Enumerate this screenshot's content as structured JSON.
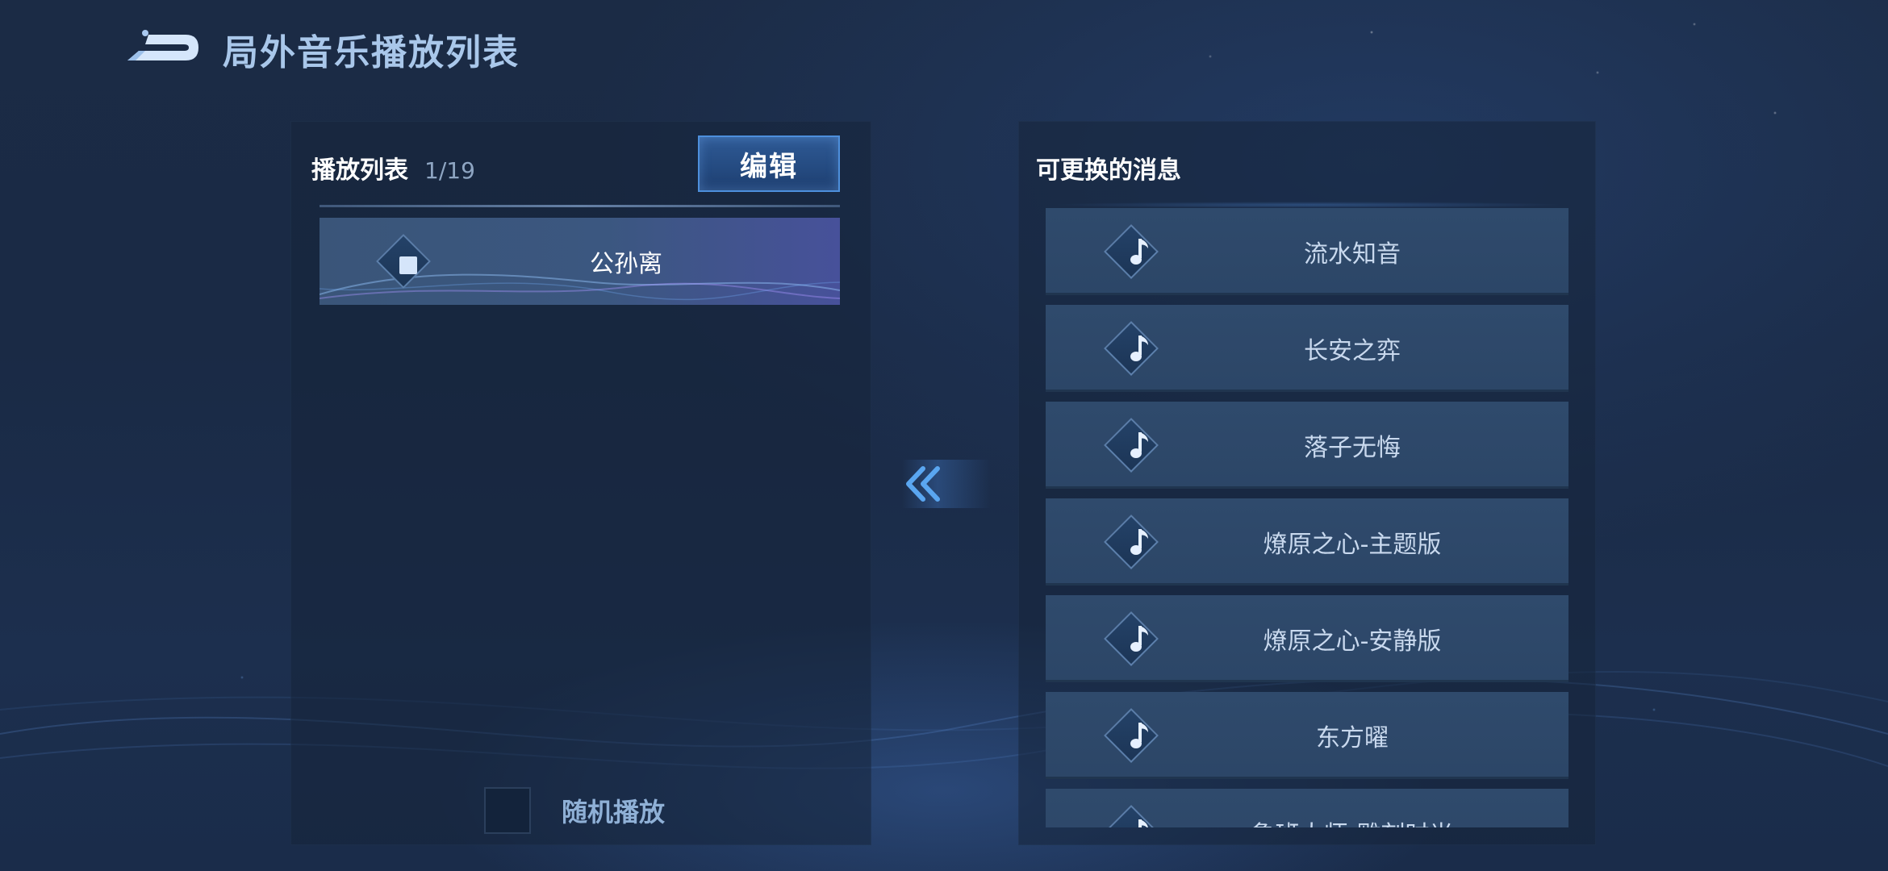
{
  "header": {
    "title": "局外音乐播放列表"
  },
  "playlist": {
    "title": "播放列表",
    "count": "1/19",
    "edit_label": "编辑",
    "current": {
      "name": "公孙离",
      "icon": "stop-icon"
    },
    "shuffle_label": "随机播放",
    "shuffle_checked": false
  },
  "available": {
    "title": "可更换的消息",
    "tracks": [
      {
        "name": "流水知音",
        "icon": "music-note-icon"
      },
      {
        "name": "长安之弈",
        "icon": "music-note-icon"
      },
      {
        "name": "落子无悔",
        "icon": "music-note-icon"
      },
      {
        "name": "燎原之心-主题版",
        "icon": "music-note-icon"
      },
      {
        "name": "燎原之心-安静版",
        "icon": "music-note-icon"
      },
      {
        "name": "东方曜",
        "icon": "music-note-icon"
      },
      {
        "name": "鲁班大师-雕刻时光",
        "icon": "music-note-icon"
      }
    ]
  },
  "colors": {
    "accent": "#4d8fdc",
    "title_text": "#a9c7ea",
    "background": "#1b2b45"
  }
}
